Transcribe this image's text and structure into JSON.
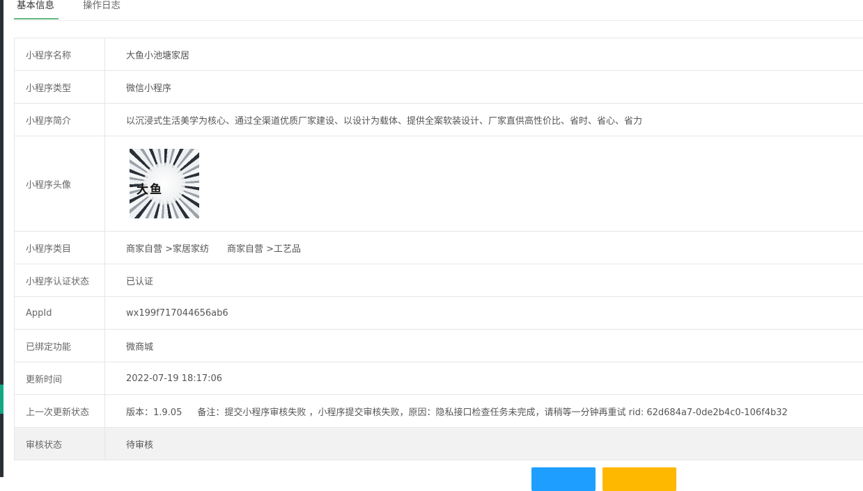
{
  "tabs": {
    "basic_info": "基本信息",
    "operation_log": "操作日志"
  },
  "info": {
    "name_label": "小程序名称",
    "name_value": "大鱼小池塘家居",
    "type_label": "小程序类型",
    "type_value": "微信小程序",
    "intro_label": "小程序简介",
    "intro_value": "以沉浸式生活美学为核心、通过全渠道优质厂家建设、以设计为载体、提供全案软装设计、厂家直供高性价比、省时、省心、省力",
    "avatar_label": "小程序头像",
    "avatar_logo_text": "大鱼",
    "category_label": "小程序类目",
    "category_values": [
      "商家自营 >家居家纺",
      "商家自营 >工艺品"
    ],
    "cert_label": "小程序认证状态",
    "cert_value": "已认证",
    "appid_label": "AppId",
    "appid_value": "wx199f717044656ab6",
    "bound_label": "已绑定功能",
    "bound_value": "微商城",
    "update_time_label": "更新时间",
    "update_time_value": "2022-07-19 18:17:06",
    "last_update_label": "上一次更新状态",
    "last_update_version": "版本：1.9.05",
    "last_update_note": "备注：提交小程序审核失败 ，小程序提交审核失败，原因：隐私接口检查任务未完成，请稍等一分钟再重试 rid: 62d684a7-0de2b4c0-106f4b32",
    "review_label": "审核状态",
    "review_value": "待审核"
  },
  "colors": {
    "tab_active_underline": "#5fb878",
    "button_blue": "#1e9fff",
    "button_yellow": "#ffb800",
    "left_rail": "#2b2f36",
    "left_rail_accent": "#11a883"
  }
}
